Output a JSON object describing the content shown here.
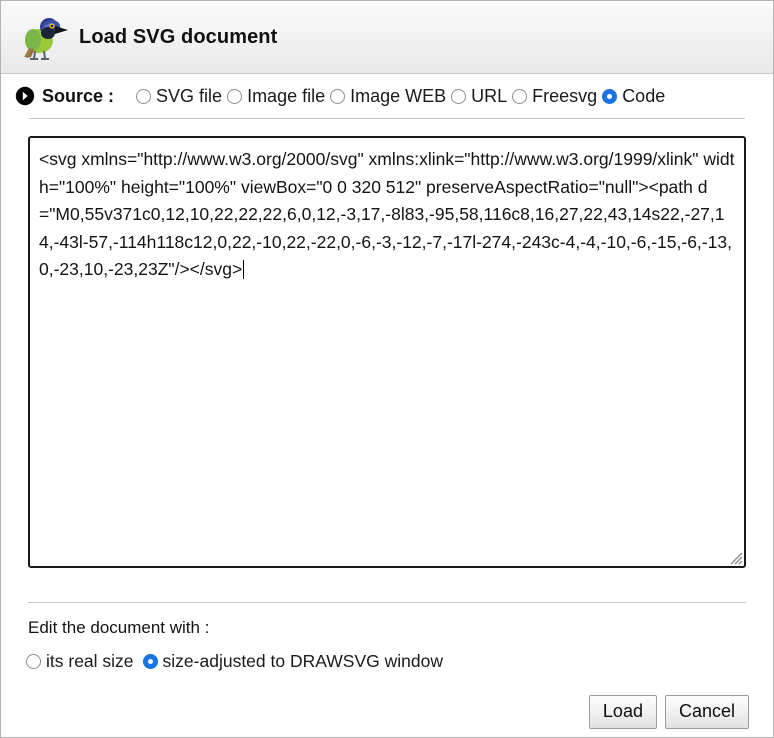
{
  "window": {
    "title": "Load SVG document",
    "logo_icon": "green-jay-bird-icon"
  },
  "source": {
    "arrow_icon": "chevron-right-circle-icon",
    "label": "Source :",
    "options": [
      {
        "label": "SVG file",
        "selected": false
      },
      {
        "label": "Image file",
        "selected": false
      },
      {
        "label": "Image WEB",
        "selected": false
      },
      {
        "label": "URL",
        "selected": false
      },
      {
        "label": "Freesvg",
        "selected": false
      },
      {
        "label": "Code",
        "selected": true
      }
    ]
  },
  "code_editor": {
    "value": "<svg xmlns=\"http://www.w3.org/2000/svg\" xmlns:xlink=\"http://www.w3.org/1999/xlink\" width=\"100%\" height=\"100%\" viewBox=\"0 0 320 512\" preserveAspectRatio=\"null\"><path d=\"M0,55v371c0,12,10,22,22,22,6,0,12,-3,17,-8l83,-95,58,116c8,16,27,22,43,14s22,-27,14,-43l-57,-114h118c12,0,22,-10,22,-22,0,-6,-3,-12,-7,-17l-274,-243c-4,-4,-10,-6,-15,-6,-13,0,-23,10,-23,23Z\"/></svg>",
    "placeholder": "",
    "resize_grip_icon": "resize-grip-icon"
  },
  "edit_section": {
    "label": "Edit the document with :",
    "options": [
      {
        "label": "its real size",
        "selected": false
      },
      {
        "label": "size-adjusted to DRAWSVG window",
        "selected": true
      }
    ]
  },
  "buttons": {
    "load": "Load",
    "cancel": "Cancel"
  },
  "colors": {
    "accent": "#1a73e8",
    "text": "#141414",
    "border": "#1a1a1a",
    "divider": "#c7c7c7"
  }
}
